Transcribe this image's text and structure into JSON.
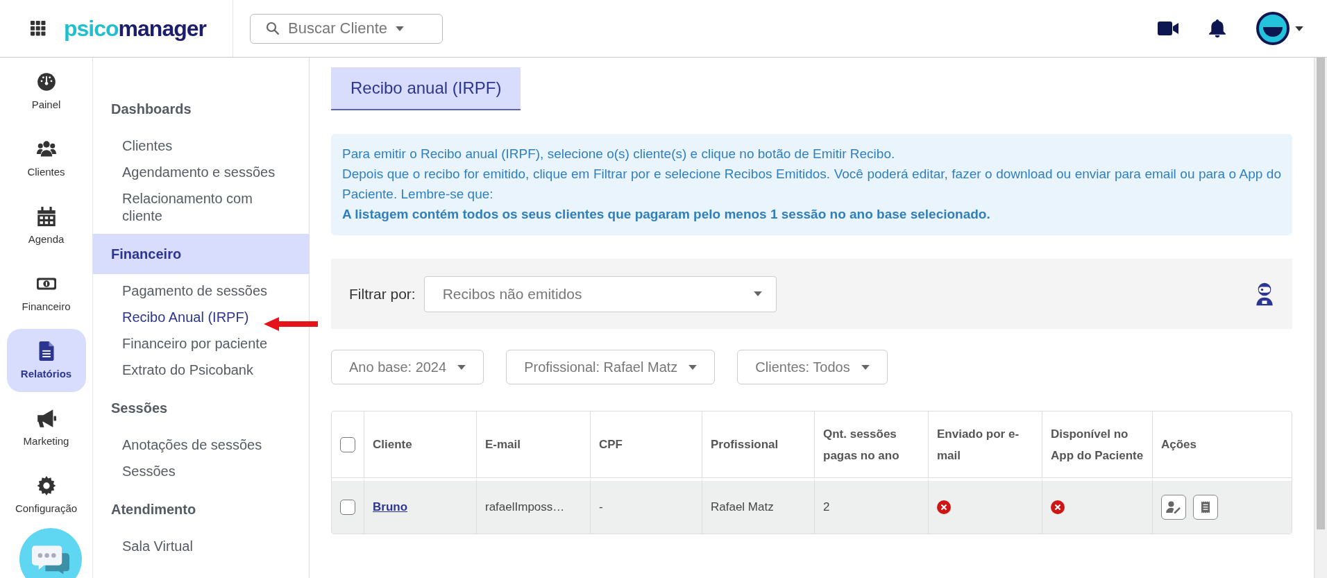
{
  "topbar": {
    "logo": [
      "psico",
      "manager"
    ],
    "search_placeholder": "Buscar Cliente"
  },
  "rail": [
    {
      "label": "Painel",
      "kind": "gauge",
      "selected": false
    },
    {
      "label": "Clientes",
      "kind": "users",
      "selected": false
    },
    {
      "label": "Agenda",
      "kind": "calendar",
      "selected": false
    },
    {
      "label": "Financeiro",
      "kind": "money",
      "selected": false
    },
    {
      "label": "Relatórios",
      "kind": "document",
      "selected": true
    },
    {
      "label": "Marketing",
      "kind": "megaphone",
      "selected": false
    },
    {
      "label": "Configuração",
      "kind": "gear",
      "selected": false
    }
  ],
  "sidebar": [
    {
      "heading": "Dashboards",
      "selected": false,
      "items": [
        {
          "label": "Clientes",
          "selected": false
        },
        {
          "label": "Agendamento e sessões",
          "selected": false
        },
        {
          "label": "Relacionamento com cliente",
          "selected": false
        }
      ]
    },
    {
      "heading": "Financeiro",
      "selected": true,
      "items": [
        {
          "label": "Pagamento de sessões",
          "selected": false
        },
        {
          "label": "Recibo Anual (IRPF)",
          "selected": true
        },
        {
          "label": "Financeiro por paciente",
          "selected": false
        },
        {
          "label": "Extrato do Psicobank",
          "selected": false
        }
      ]
    },
    {
      "heading": "Sessões",
      "selected": false,
      "items": [
        {
          "label": "Anotações de sessões",
          "selected": false
        },
        {
          "label": "Sessões",
          "selected": false
        }
      ]
    },
    {
      "heading": "Atendimento",
      "selected": false,
      "items": [
        {
          "label": "Sala Virtual",
          "selected": false
        }
      ]
    }
  ],
  "page_title": "Recibo anual (IRPF)",
  "info": {
    "lines": [
      "Para emitir o Recibo anual (IRPF), selecione o(s) cliente(s) e clique no botão de Emitir Recibo.",
      "Depois que o recibo for emitido, clique em Filtrar por e selecione Recibos Emitidos. Você poderá editar, fazer o download ou enviar para email ou para o App do Paciente. Lembre-se que:"
    ],
    "emphasis": "A listagem contém todos os seus clientes que pagaram pelo menos 1 sessão no ano base selecionado."
  },
  "filter": {
    "label": "Filtrar por:",
    "value": "Recibos não emitidos"
  },
  "chips": [
    "Ano base: 2024",
    "Profissional: Rafael Matz",
    "Clientes: Todos"
  ],
  "table": {
    "all_checked": false,
    "columns": [
      "Cliente",
      "E-mail",
      "CPF",
      "Profissional",
      "Qnt. sessões pagas no ano",
      "Enviado por e-mail",
      "Disponível no App do Paciente",
      "Ações"
    ],
    "rows": [
      {
        "checked": false,
        "client": "Bruno",
        "email": "rafaelImposs…",
        "cpf": "-",
        "professional": "Rafael Matz",
        "sessions": "2",
        "sent_email": false,
        "in_app": false
      }
    ]
  }
}
